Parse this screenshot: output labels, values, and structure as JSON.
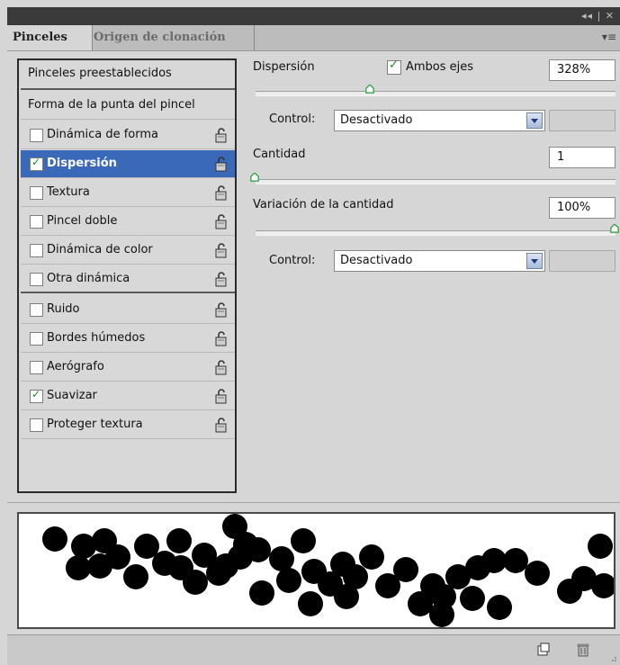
{
  "panel": {
    "controls": "◂◂ | ✕",
    "menu_glyph": "▾≡"
  },
  "tabs": {
    "active": "Pinceles",
    "inactive": "Origen de clonación"
  },
  "left_list": {
    "presets": "Pinceles preestablecidos",
    "tip_shape": "Forma de la punta del pincel",
    "items": [
      {
        "label": "Dinámica de forma",
        "checked": false,
        "selected": false
      },
      {
        "label": "Dispersión",
        "checked": true,
        "selected": true
      },
      {
        "label": "Textura",
        "checked": false,
        "selected": false
      },
      {
        "label": "Pincel doble",
        "checked": false,
        "selected": false
      },
      {
        "label": "Dinámica de color",
        "checked": false,
        "selected": false
      },
      {
        "label": "Otra dinámica",
        "checked": false,
        "selected": false
      },
      {
        "label": "Ruido",
        "checked": false,
        "selected": false
      },
      {
        "label": "Bordes húmedos",
        "checked": false,
        "selected": false
      },
      {
        "label": "Aerógrafo",
        "checked": false,
        "selected": false
      },
      {
        "label": "Suavizar",
        "checked": true,
        "selected": false
      },
      {
        "label": "Proteger textura",
        "checked": false,
        "selected": false
      }
    ]
  },
  "scatter": {
    "label": "Dispersión",
    "both_axes_label": "Ambos ejes",
    "both_axes_checked": true,
    "value": "328%",
    "slider_fraction": 0.32,
    "control_label": "Control:",
    "control_value": "Desactivado"
  },
  "count": {
    "label": "Cantidad",
    "value": "1",
    "slider_fraction": 0.0
  },
  "count_jitter": {
    "label": "Variación de la cantidad",
    "value": "100%",
    "slider_fraction": 1.0,
    "control_label": "Control:",
    "control_value": "Desactivado"
  },
  "colors": {
    "selection": "#3b69b9",
    "checkmark": "#1e8a24",
    "panel_bg": "#d6d6d6"
  },
  "icons": [
    "lock-icon",
    "new-brush-icon",
    "trash-icon",
    "chevron-down-icon",
    "checkbox-icon"
  ]
}
